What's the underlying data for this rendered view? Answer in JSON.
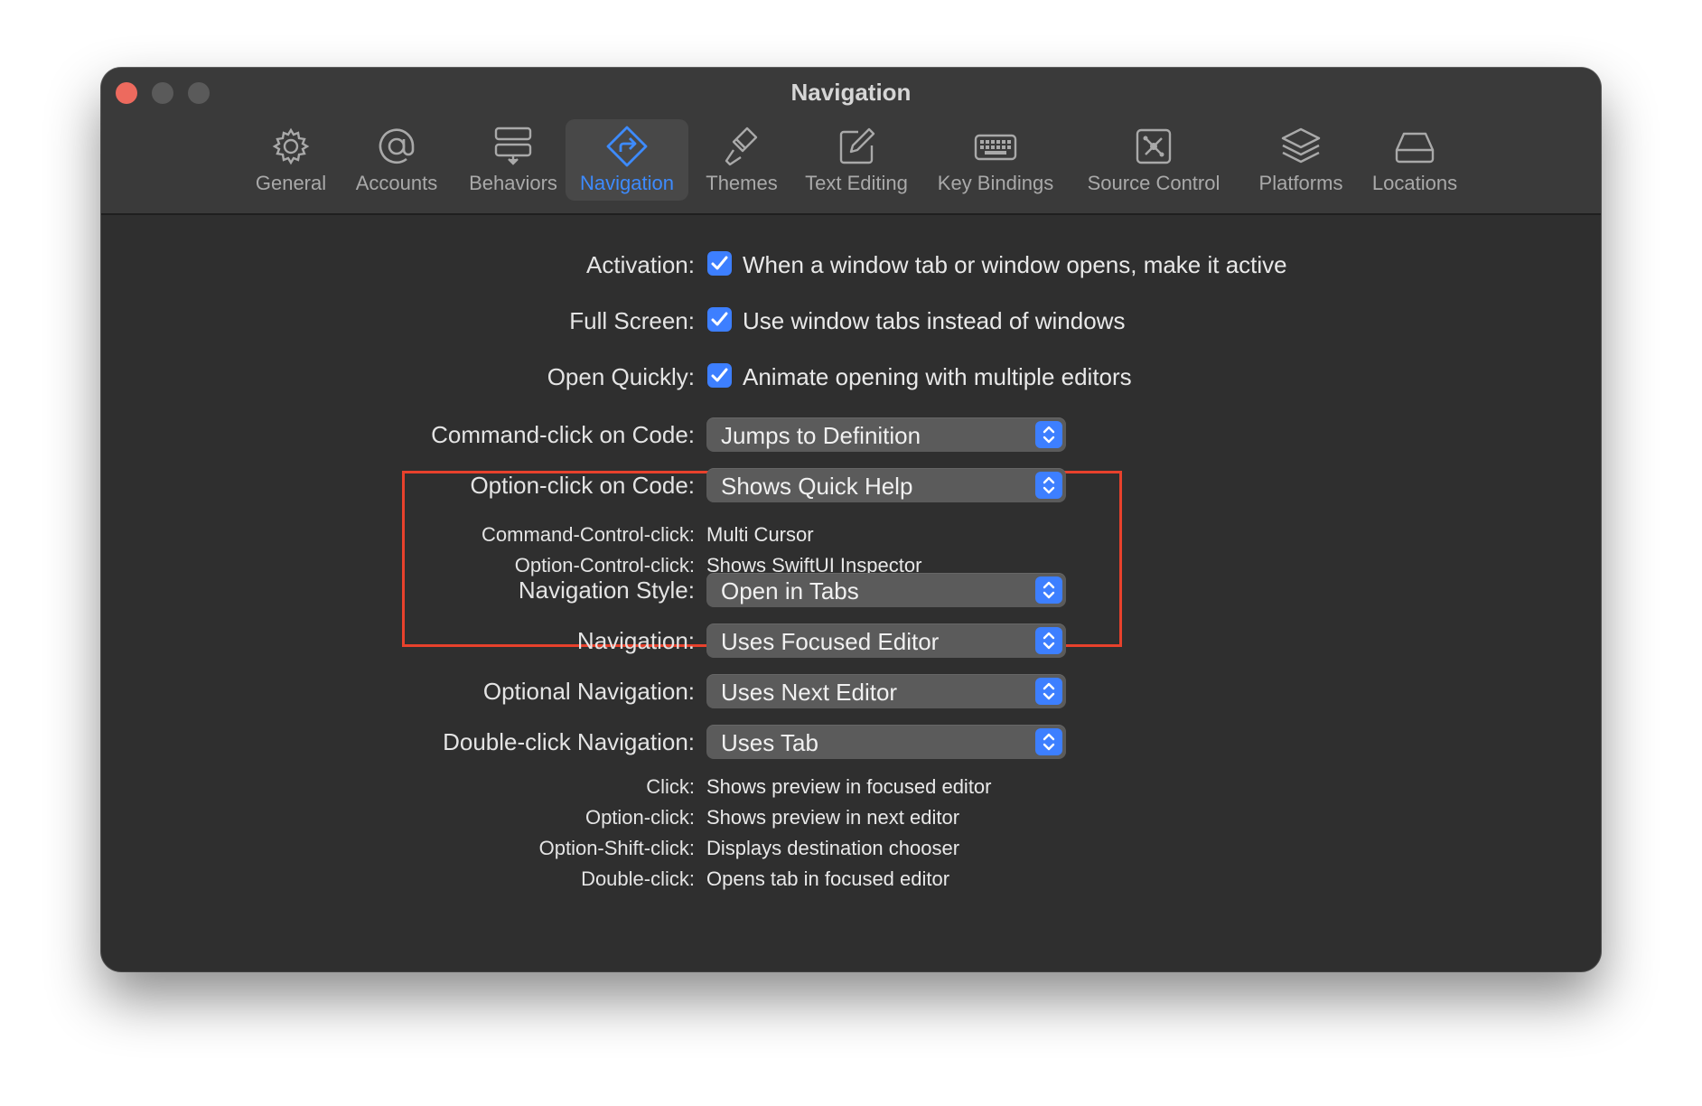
{
  "window": {
    "title": "Navigation"
  },
  "toolbar": {
    "items": [
      {
        "label": "General",
        "icon": "gear-icon"
      },
      {
        "label": "Accounts",
        "icon": "at-sign-icon"
      },
      {
        "label": "Behaviors",
        "icon": "behaviors-icon"
      },
      {
        "label": "Navigation",
        "icon": "navigation-diamond-icon",
        "selected": true
      },
      {
        "label": "Themes",
        "icon": "paintbrush-icon"
      },
      {
        "label": "Text Editing",
        "icon": "pencil-square-icon"
      },
      {
        "label": "Key Bindings",
        "icon": "keyboard-icon"
      },
      {
        "label": "Source Control",
        "icon": "source-control-icon"
      },
      {
        "label": "Platforms",
        "icon": "stacked-layers-icon"
      },
      {
        "label": "Locations",
        "icon": "drive-icon"
      }
    ]
  },
  "settings": {
    "activation": {
      "label": "Activation:",
      "checked": true,
      "text": "When a window tab or window opens, make it active"
    },
    "full_screen": {
      "label": "Full Screen:",
      "checked": true,
      "text": "Use window tabs instead of windows"
    },
    "open_quickly": {
      "label": "Open Quickly:",
      "checked": true,
      "text": "Animate opening with multiple editors"
    },
    "command_click": {
      "label": "Command-click on Code:",
      "value": "Jumps to Definition"
    },
    "option_click_code": {
      "label": "Option-click on Code:",
      "value": "Shows Quick Help"
    },
    "command_control_click": {
      "label": "Command-Control-click:",
      "value": "Multi Cursor"
    },
    "option_control_click": {
      "label": "Option-Control-click:",
      "value": "Shows SwiftUI Inspector"
    },
    "navigation_style": {
      "label": "Navigation Style:",
      "value": "Open in Tabs"
    },
    "navigation": {
      "label": "Navigation:",
      "value": "Uses Focused Editor"
    },
    "optional_navigation": {
      "label": "Optional Navigation:",
      "value": "Uses Next Editor"
    },
    "double_click_navigation": {
      "label": "Double-click Navigation:",
      "value": "Uses Tab"
    },
    "click": {
      "label": "Click:",
      "value": "Shows preview in focused editor"
    },
    "option_click": {
      "label": "Option-click:",
      "value": "Shows preview in next editor"
    },
    "option_shift_click": {
      "label": "Option-Shift-click:",
      "value": "Displays destination chooser"
    },
    "double_click": {
      "label": "Double-click:",
      "value": "Opens tab in focused editor"
    }
  },
  "colors": {
    "accent": "#3d7fff",
    "selected_tab_text": "#3d8bff",
    "highlight_border": "#e8412c",
    "window_bg": "#2f2f2f"
  }
}
